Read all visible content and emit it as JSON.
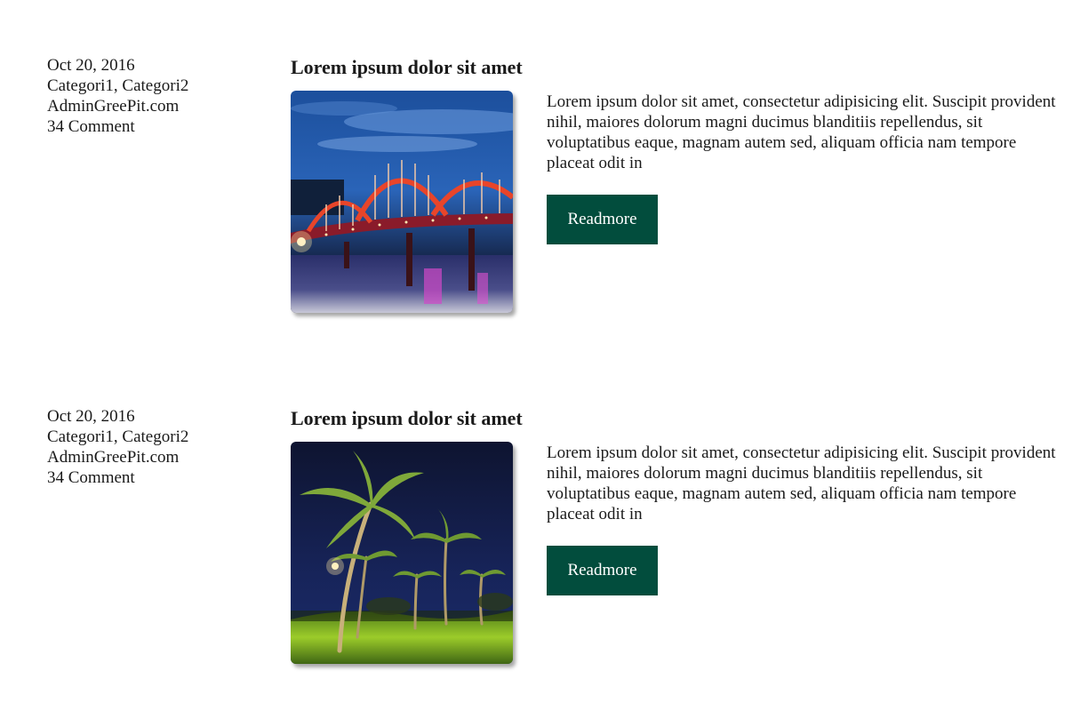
{
  "posts": [
    {
      "date": "Oct 20, 2016",
      "categories": "Categori1, Categori2",
      "author": "AdminGreePit.com",
      "comments": "34 Comment",
      "title": "Lorem ipsum dolor sit amet",
      "image": "night-bridge-photo",
      "excerpt": "Lorem ipsum dolor sit amet, consectetur adipisicing elit. Suscipit provident nihil, maiores dolorum magni ducimus blanditiis repellendus, sit voluptatibus eaque, magnam autem sed, aliquam officia nam tempore placeat odit in",
      "readmore_label": "Readmore"
    },
    {
      "date": "Oct 20, 2016",
      "categories": "Categori1, Categori2",
      "author": "AdminGreePit.com",
      "comments": "34 Comment",
      "title": "Lorem ipsum dolor sit amet",
      "image": "night-palm-trees-photo",
      "excerpt": "Lorem ipsum dolor sit amet, consectetur adipisicing elit. Suscipit provident nihil, maiores dolorum magni ducimus blanditiis repellendus, sit voluptatibus eaque, magnam autem sed, aliquam officia nam tempore placeat odit in",
      "readmore_label": "Readmore"
    }
  ],
  "colors": {
    "button_bg": "#024d3d",
    "button_text": "#ffffff",
    "text": "#1a1a1a"
  }
}
